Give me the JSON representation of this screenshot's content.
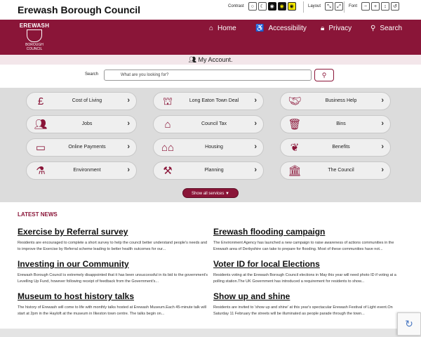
{
  "topbar": {
    "site_name": "Erewash Borough Council",
    "contrast_label": "Contrast",
    "layout_label": "Layout",
    "font_label": "Font"
  },
  "header": {
    "logo_top": "EREWASH",
    "logo_bottom": "BOROUGH COUNCIL",
    "nav": [
      {
        "label": "Home",
        "icon": "home-icon"
      },
      {
        "label": "Accessibility",
        "icon": "accessibility-icon"
      },
      {
        "label": "Privacy",
        "icon": "lock-icon"
      },
      {
        "label": "Search",
        "icon": "search-icon"
      }
    ]
  },
  "account": {
    "label": "My Account."
  },
  "search": {
    "label": "Search",
    "placeholder": "What are you looking for?"
  },
  "services": {
    "tiles": [
      {
        "label": "Cost of Living",
        "icon": "money-hand-icon"
      },
      {
        "label": "Long Eaton Town Deal",
        "icon": "town-hall-icon"
      },
      {
        "label": "Business Help",
        "icon": "handshake-icon"
      },
      {
        "label": "Jobs",
        "icon": "people-group-icon"
      },
      {
        "label": "Council Tax",
        "icon": "house-pound-icon"
      },
      {
        "label": "Bins",
        "icon": "wheelie-bin-icon"
      },
      {
        "label": "Online Payments",
        "icon": "card-payment-icon"
      },
      {
        "label": "Housing",
        "icon": "houses-icon"
      },
      {
        "label": "Benefits",
        "icon": "hands-money-icon"
      },
      {
        "label": "Environment",
        "icon": "spray-icon"
      },
      {
        "label": "Planning",
        "icon": "planner-icon"
      },
      {
        "label": "The Council",
        "icon": "council-building-icon"
      }
    ],
    "show_all": "Show all services ▼"
  },
  "news": {
    "heading": "LATEST NEWS",
    "articles": [
      {
        "title": "Exercise by Referral survey",
        "body": "Residents are encouraged to complete a short survey to help the council better understand people's needs and to improve the Exercise by Referral scheme leading to better health outcomes for our..."
      },
      {
        "title": "Erewash flooding campaign",
        "body": "The Environment Agency has launched a new campaign to raise awareness of actions communities in the Erewash area of Derbyshire can take to prepare for flooding. Most of these communities have not..."
      },
      {
        "title": "Investing in our Community",
        "body": "Erewash Borough Council is extremely disappointed that it has been unsuccessful in its bid to the government's Levelling Up Fund, however following receipt of feedback from the Government's..."
      },
      {
        "title": "Voter ID for local Elections",
        "body": "Residents voting at the Erewash Borough Council elections in May this year will need photo ID if voting at a polling station.The UK Government has introduced a requirement for residents to show..."
      },
      {
        "title": "Museum to host history talks",
        "body": "The history of Erewash will come to life with monthly talks hosted at Erewash Museum.Each 45-minute talk will start at 2pm in the Hayloft at the museum in Ilkeston town centre. The talks begin on..."
      },
      {
        "title": "Show up and shine",
        "body": "Residents are invited to 'show up and shine' at this year's spectacular Erewash Festival of Light event.On Saturday 11 February the streets will be illuminated as people parade through the town..."
      }
    ]
  },
  "colors": {
    "brand": "#8a1538",
    "tile_bg": "#efefef",
    "panel_bg": "#dcdcdc"
  }
}
